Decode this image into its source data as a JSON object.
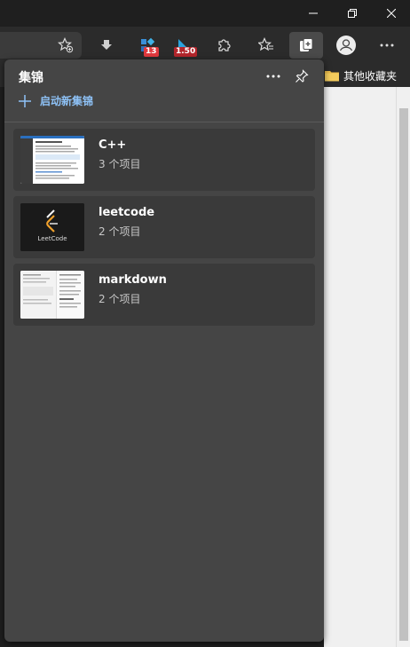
{
  "window_controls": {
    "minimize_icon": "minimize-icon",
    "restore_icon": "restore-icon",
    "close_icon": "close-icon"
  },
  "toolbar": {
    "extension_badge_1": "13",
    "extension_badge_2": "1.50",
    "badge_color_1": "#e0393e",
    "badge_color_2": "#b3262c"
  },
  "favorites_bar": {
    "other_favorites": "其他收藏夹"
  },
  "collections_panel": {
    "title": "集锦",
    "new_collection": "启动新集锦",
    "accent_color": "#8ec2f7",
    "items": [
      {
        "name": "C++",
        "count": "3 个项目"
      },
      {
        "name": "leetcode",
        "count": "2 个项目",
        "thumb_text": "LeetCode"
      },
      {
        "name": "markdown",
        "count": "2 个项目"
      }
    ]
  }
}
